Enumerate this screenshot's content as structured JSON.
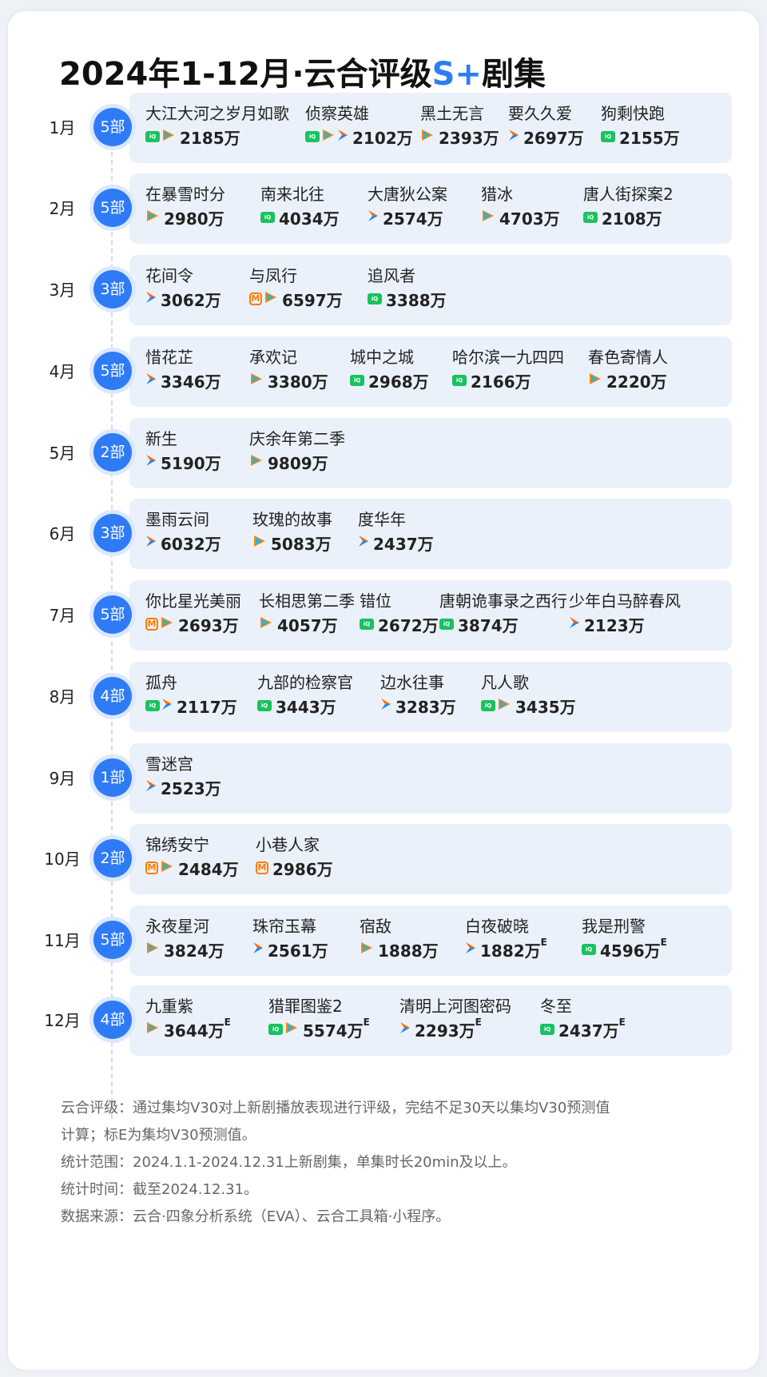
{
  "title": {
    "prefix": "2024年1-12月·云合评级",
    "accent": "S+",
    "suffix": "剧集"
  },
  "colors": {
    "accent": "#2f7bf5",
    "panel": "#ebf1fa",
    "iqiyi": "#19c25f",
    "tencent_orange": "#ff8a00",
    "tencent_blue": "#1e88f5",
    "mango": "#ff7a00"
  },
  "months": [
    {
      "label": "1月",
      "count": "5部",
      "shows": [
        {
          "name": "大江大河之岁月如歌",
          "platforms": [
            "iqiyi",
            "tencent"
          ],
          "value": "2185万",
          "e": ""
        },
        {
          "name": "侦察英雄",
          "platforms": [
            "iqiyi",
            "tencent",
            "youku"
          ],
          "value": "2102万",
          "e": ""
        },
        {
          "name": "黑土无言",
          "platforms": [
            "tencent"
          ],
          "value": "2393万",
          "e": ""
        },
        {
          "name": "要久久爱",
          "platforms": [
            "youku"
          ],
          "value": "2697万",
          "e": ""
        },
        {
          "name": "狗剩快跑",
          "platforms": [
            "iqiyi"
          ],
          "value": "2155万",
          "e": ""
        }
      ]
    },
    {
      "label": "2月",
      "count": "5部",
      "shows": [
        {
          "name": "在暴雪时分",
          "platforms": [
            "tencent"
          ],
          "value": "2980万",
          "e": ""
        },
        {
          "name": "南来北往",
          "platforms": [
            "iqiyi"
          ],
          "value": "4034万",
          "e": ""
        },
        {
          "name": "大唐狄公案",
          "platforms": [
            "youku"
          ],
          "value": "2574万",
          "e": ""
        },
        {
          "name": "猎冰",
          "platforms": [
            "tencent"
          ],
          "value": "4703万",
          "e": ""
        },
        {
          "name": "唐人街探案2",
          "platforms": [
            "iqiyi"
          ],
          "value": "2108万",
          "e": ""
        }
      ]
    },
    {
      "label": "3月",
      "count": "3部",
      "shows": [
        {
          "name": "花间令",
          "platforms": [
            "youku"
          ],
          "value": "3062万",
          "e": ""
        },
        {
          "name": "与凤行",
          "platforms": [
            "mango",
            "tencent"
          ],
          "value": "6597万",
          "e": ""
        },
        {
          "name": "追风者",
          "platforms": [
            "iqiyi"
          ],
          "value": "3388万",
          "e": ""
        }
      ]
    },
    {
      "label": "4月",
      "count": "5部",
      "shows": [
        {
          "name": "惜花芷",
          "platforms": [
            "youku"
          ],
          "value": "3346万",
          "e": ""
        },
        {
          "name": "承欢记",
          "platforms": [
            "tencent"
          ],
          "value": "3380万",
          "e": ""
        },
        {
          "name": "城中之城",
          "platforms": [
            "iqiyi"
          ],
          "value": "2968万",
          "e": ""
        },
        {
          "name": "哈尔滨一九四四",
          "platforms": [
            "iqiyi"
          ],
          "value": "2166万",
          "e": ""
        },
        {
          "name": "春色寄情人",
          "platforms": [
            "tencent"
          ],
          "value": "2220万",
          "e": ""
        }
      ]
    },
    {
      "label": "5月",
      "count": "2部",
      "shows": [
        {
          "name": "新生",
          "platforms": [
            "youku"
          ],
          "value": "5190万",
          "e": ""
        },
        {
          "name": "庆余年第二季",
          "platforms": [
            "tencent"
          ],
          "value": "9809万",
          "e": ""
        }
      ]
    },
    {
      "label": "6月",
      "count": "3部",
      "shows": [
        {
          "name": "墨雨云间",
          "platforms": [
            "youku"
          ],
          "value": "6032万",
          "e": ""
        },
        {
          "name": "玫瑰的故事",
          "platforms": [
            "tencent"
          ],
          "value": "5083万",
          "e": ""
        },
        {
          "name": "度华年",
          "platforms": [
            "youku"
          ],
          "value": "2437万",
          "e": ""
        }
      ]
    },
    {
      "label": "7月",
      "count": "5部",
      "shows": [
        {
          "name": "你比星光美丽",
          "platforms": [
            "mango",
            "tencent"
          ],
          "value": "2693万",
          "e": ""
        },
        {
          "name": "长相思第二季",
          "platforms": [
            "tencent"
          ],
          "value": "4057万",
          "e": ""
        },
        {
          "name": "错位",
          "platforms": [
            "iqiyi"
          ],
          "value": "2672万",
          "e": ""
        },
        {
          "name": "唐朝诡事录之西行",
          "platforms": [
            "iqiyi"
          ],
          "value": "3874万",
          "e": ""
        },
        {
          "name": "少年白马醉春风",
          "platforms": [
            "youku"
          ],
          "value": "2123万",
          "e": ""
        }
      ]
    },
    {
      "label": "8月",
      "count": "4部",
      "shows": [
        {
          "name": "孤舟",
          "platforms": [
            "iqiyi",
            "youku"
          ],
          "value": "2117万",
          "e": ""
        },
        {
          "name": "九部的检察官",
          "platforms": [
            "iqiyi"
          ],
          "value": "3443万",
          "e": ""
        },
        {
          "name": "边水往事",
          "platforms": [
            "youku"
          ],
          "value": "3283万",
          "e": ""
        },
        {
          "name": "凡人歌",
          "platforms": [
            "iqiyi",
            "tencent"
          ],
          "value": "3435万",
          "e": ""
        }
      ]
    },
    {
      "label": "9月",
      "count": "1部",
      "shows": [
        {
          "name": "雪迷宫",
          "platforms": [
            "youku"
          ],
          "value": "2523万",
          "e": ""
        }
      ]
    },
    {
      "label": "10月",
      "count": "2部",
      "shows": [
        {
          "name": "锦绣安宁",
          "platforms": [
            "mango",
            "tencent"
          ],
          "value": "2484万",
          "e": ""
        },
        {
          "name": "小巷人家",
          "platforms": [
            "mango"
          ],
          "value": "2986万",
          "e": ""
        }
      ]
    },
    {
      "label": "11月",
      "count": "5部",
      "shows": [
        {
          "name": "永夜星河",
          "platforms": [
            "tencent"
          ],
          "value": "3824万",
          "e": ""
        },
        {
          "name": "珠帘玉幕",
          "platforms": [
            "youku"
          ],
          "value": "2561万",
          "e": ""
        },
        {
          "name": "宿敌",
          "platforms": [
            "tencent"
          ],
          "value": "1888万",
          "e": ""
        },
        {
          "name": "白夜破晓",
          "platforms": [
            "youku"
          ],
          "value": "1882万",
          "e": "E"
        },
        {
          "name": "我是刑警",
          "platforms": [
            "iqiyi"
          ],
          "value": "4596万",
          "e": "E"
        }
      ]
    },
    {
      "label": "12月",
      "count": "4部",
      "shows": [
        {
          "name": "九重紫",
          "platforms": [
            "tencent"
          ],
          "value": "3644万",
          "e": "E"
        },
        {
          "name": "猎罪图鉴2",
          "platforms": [
            "iqiyi",
            "tencent"
          ],
          "value": "5574万",
          "e": "E"
        },
        {
          "name": "清明上河图密码",
          "platforms": [
            "youku"
          ],
          "value": "2293万",
          "e": "E"
        },
        {
          "name": "冬至",
          "platforms": [
            "iqiyi"
          ],
          "value": "2437万",
          "e": "E"
        }
      ]
    }
  ],
  "notes": [
    "云合评级：通过集均V30对上新剧播放表现进行评级，完结不足30天以集均V30预测值",
    "计算；标E为集均V30预测值。",
    "统计范围：2024.1.1-2024.12.31上新剧集，单集时长20min及以上。",
    "统计时间：截至2024.12.31。",
    "数据来源：云合·四象分析系统（EVA）、云合工具箱·小程序。"
  ]
}
